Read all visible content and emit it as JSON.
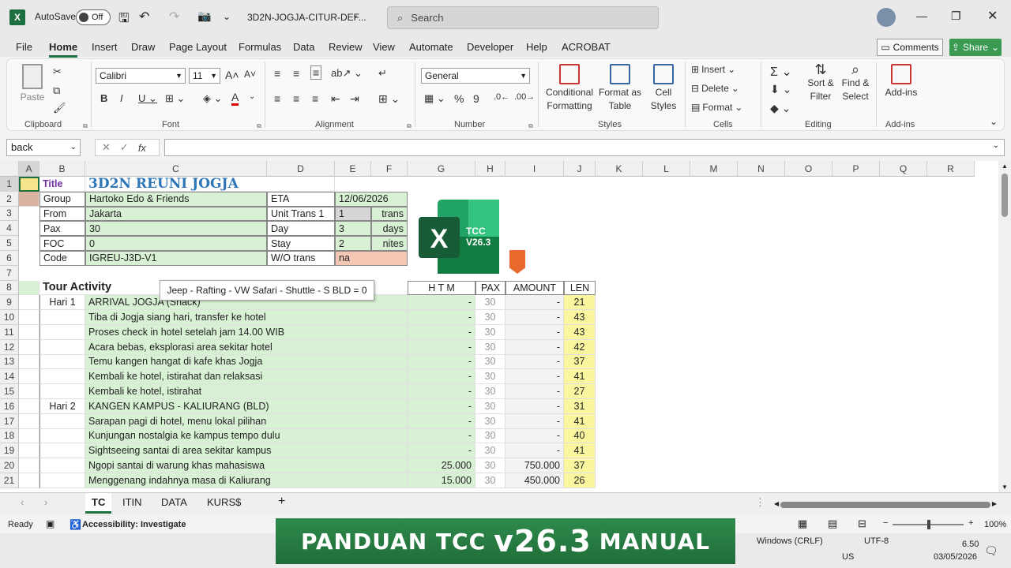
{
  "titlebar": {
    "autosave_label": "AutoSave",
    "autosave_state": "Off",
    "filename": "3D2N-JOGJA-CITUR-DEF...",
    "search_placeholder": "Search"
  },
  "menu": [
    "File",
    "Home",
    "Insert",
    "Draw",
    "Page Layout",
    "Formulas",
    "Data",
    "Review",
    "View",
    "Automate",
    "Developer",
    "Help",
    "ACROBAT"
  ],
  "menu_active": "Home",
  "comments_label": "Comments",
  "share_label": "Share",
  "ribbon": {
    "paste": "Paste",
    "font_name": "Calibri",
    "font_size": "11",
    "number_format": "General",
    "conditional_formatting": [
      "Conditional",
      "Formatting"
    ],
    "format_as_table": [
      "Format as",
      "Table"
    ],
    "cell_styles": [
      "Cell",
      "Styles"
    ],
    "insert": "Insert",
    "delete": "Delete",
    "format": "Format",
    "sort_filter": [
      "Sort &",
      "Filter"
    ],
    "find_select": [
      "Find &",
      "Select"
    ],
    "addins": "Add-ins",
    "groups": [
      "Clipboard",
      "Font",
      "Alignment",
      "Number",
      "Styles",
      "Cells",
      "Editing",
      "Add-ins"
    ]
  },
  "namebox": "back",
  "columns": [
    "A",
    "B",
    "C",
    "D",
    "E",
    "F",
    "G",
    "H",
    "I",
    "J",
    "K",
    "L",
    "M",
    "N",
    "O",
    "P",
    "Q",
    "R"
  ],
  "rows": [
    "1",
    "2",
    "3",
    "4",
    "5",
    "6",
    "7",
    "8",
    "9",
    "10",
    "11",
    "12",
    "13",
    "14",
    "15",
    "16",
    "17",
    "18",
    "19",
    "20",
    "21"
  ],
  "header_block": {
    "title_label": "Title",
    "title_value": "3D2N REUNI JOGJA",
    "group_label": "Group",
    "group_value": "Hartoko Edo & Friends",
    "from_label": "From",
    "from_value": "Jakarta",
    "pax_label": "Pax",
    "pax_value": "30",
    "foc_label": "FOC",
    "foc_value": "0",
    "code_label": "Code",
    "code_value": "IGREU-J3D-V1",
    "eta_label": "ETA",
    "eta_value": "12/06/2026",
    "unit_label": "Unit Trans 1",
    "unit_value": "1",
    "unit_suffix": "trans",
    "day_label": "Day",
    "day_value": "3",
    "day_suffix": "days",
    "stay_label": "Stay",
    "stay_value": "2",
    "stay_suffix": "nites",
    "wo_label": "W/O trans",
    "wo_value": "na"
  },
  "tooltip": "Jeep - Rafting - VW Safari - Shuttle - S BLD = 0",
  "logo_text": [
    "TCC",
    "V26.3"
  ],
  "activity": {
    "title": "Tour Activity",
    "headers": [
      "H T M",
      "PAX",
      "AMOUNT",
      "LEN"
    ],
    "rows": [
      {
        "day": "Hari 1",
        "desc": "ARRIVAL JOGJA (Snack)",
        "htm": "-",
        "pax": "30",
        "amount": "-",
        "len": "21"
      },
      {
        "day": "",
        "desc": "Tiba di Jogja siang hari, transfer ke hotel",
        "htm": "-",
        "pax": "30",
        "amount": "-",
        "len": "43"
      },
      {
        "day": "",
        "desc": "Proses check in hotel setelah jam 14.00 WIB",
        "htm": "-",
        "pax": "30",
        "amount": "-",
        "len": "43"
      },
      {
        "day": "",
        "desc": "Acara bebas, eksplorasi area sekitar hotel",
        "htm": "-",
        "pax": "30",
        "amount": "-",
        "len": "42"
      },
      {
        "day": "",
        "desc": "Temu kangen hangat di kafe khas Jogja",
        "htm": "-",
        "pax": "30",
        "amount": "-",
        "len": "37"
      },
      {
        "day": "",
        "desc": "Kembali ke hotel, istirahat dan relaksasi",
        "htm": "-",
        "pax": "30",
        "amount": "-",
        "len": "41"
      },
      {
        "day": "",
        "desc": "Kembali ke hotel, istirahat",
        "htm": "-",
        "pax": "30",
        "amount": "-",
        "len": "27"
      },
      {
        "day": "Hari 2",
        "desc": "KANGEN KAMPUS - KALIURANG (BLD)",
        "htm": "-",
        "pax": "30",
        "amount": "-",
        "len": "31"
      },
      {
        "day": "",
        "desc": "Sarapan pagi di hotel, menu lokal pilihan",
        "htm": "-",
        "pax": "30",
        "amount": "-",
        "len": "41"
      },
      {
        "day": "",
        "desc": "Kunjungan nostalgia ke kampus tempo dulu",
        "htm": "-",
        "pax": "30",
        "amount": "-",
        "len": "40"
      },
      {
        "day": "",
        "desc": "Sightseeing santai di area sekitar kampus",
        "htm": "-",
        "pax": "30",
        "amount": "-",
        "len": "41"
      },
      {
        "day": "",
        "desc": "Ngopi santai di warung khas mahasiswa",
        "htm": "25.000",
        "pax": "30",
        "amount": "750.000",
        "len": "37"
      },
      {
        "day": "",
        "desc": "Menggenang indahnya masa di Kaliurang",
        "htm": "15.000",
        "pax": "30",
        "amount": "450.000",
        "len": "26"
      }
    ]
  },
  "sheet_tabs": [
    "TC",
    "ITIN",
    "DATA",
    "KURS$"
  ],
  "active_tab": "TC",
  "status": {
    "ready": "Ready",
    "accessibility": "Accessibility: Investigate",
    "zoom": "100%",
    "line_ending": "Windows (CRLF)",
    "encoding": "UTF-8"
  },
  "banner": {
    "prefix": "PANDUAN TCC",
    "version": "v26.3",
    "suffix": "MANUAL"
  },
  "taskbar": {
    "lang": "US",
    "time": "6.50",
    "date": "03/05/2026"
  }
}
